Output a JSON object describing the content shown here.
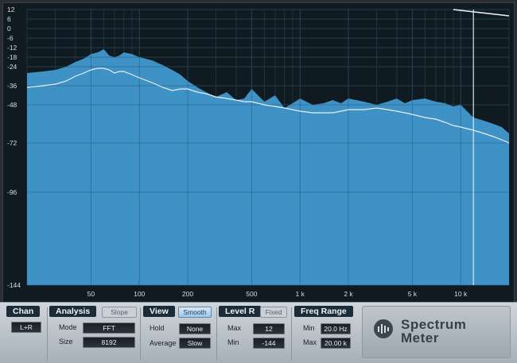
{
  "app": {
    "title": "Spectrum Meter"
  },
  "chart_data": {
    "type": "area",
    "x_scale": "log",
    "y_ticks": [
      12,
      6,
      0,
      -6,
      -12,
      -18,
      -24,
      -36,
      -48,
      -72,
      -96,
      -144
    ],
    "x_ticks": [
      {
        "value": 50,
        "label": "50"
      },
      {
        "value": 100,
        "label": "100"
      },
      {
        "value": 200,
        "label": "200"
      },
      {
        "value": 500,
        "label": "500"
      },
      {
        "value": 1000,
        "label": "1 k"
      },
      {
        "value": 2000,
        "label": "2 k"
      },
      {
        "value": 5000,
        "label": "5 k"
      },
      {
        "value": 10000,
        "label": "10 k"
      }
    ],
    "xlim": [
      20,
      20000
    ],
    "ylim": [
      -144,
      12
    ],
    "series": [
      {
        "color": "#3f92c6",
        "x": [
          20,
          25,
          30,
          35,
          40,
          45,
          50,
          55,
          60,
          65,
          70,
          75,
          80,
          90,
          100,
          120,
          140,
          160,
          180,
          200,
          230,
          260,
          300,
          350,
          400,
          450,
          500,
          600,
          700,
          800,
          900,
          1000,
          1200,
          1400,
          1600,
          1800,
          2000,
          2500,
          3000,
          3500,
          4000,
          4500,
          5000,
          6000,
          7000,
          8000,
          9000,
          10000,
          12000,
          14000,
          16000,
          18000,
          20000
        ],
        "y": [
          -28,
          -27,
          -26,
          -24,
          -21,
          -19,
          -16,
          -15,
          -13,
          -17,
          -18,
          -17,
          -15,
          -16,
          -18,
          -20,
          -23,
          -26,
          -29,
          -33,
          -37,
          -40,
          -43,
          -40,
          -45,
          -44,
          -38,
          -46,
          -42,
          -50,
          -47,
          -44,
          -48,
          -47,
          -45,
          -47,
          -44,
          -46,
          -48,
          -46,
          -44,
          -47,
          -45,
          -44,
          -46,
          -47,
          -49,
          -48,
          -56,
          -58,
          -60,
          -62,
          -66
        ]
      },
      {
        "color": "#e8eef2",
        "x": [
          20,
          25,
          30,
          35,
          40,
          45,
          50,
          55,
          60,
          65,
          70,
          75,
          80,
          90,
          100,
          120,
          140,
          160,
          180,
          200,
          230,
          260,
          300,
          350,
          400,
          450,
          500,
          600,
          700,
          800,
          900,
          1000,
          1200,
          1400,
          1600,
          1800,
          2000,
          2500,
          3000,
          3500,
          4000,
          4500,
          5000,
          6000,
          7000,
          8000,
          9000,
          10000,
          12000,
          14000,
          16000,
          18000,
          20000
        ],
        "y": [
          -37,
          -36,
          -35,
          -33,
          -30,
          -28,
          -26,
          -25,
          -25,
          -26,
          -28,
          -27,
          -27,
          -29,
          -31,
          -34,
          -37,
          -39,
          -38,
          -38,
          -40,
          -41,
          -43,
          -44,
          -45,
          -46,
          -46,
          -48,
          -49,
          -50,
          -51,
          -52,
          -53,
          -53,
          -53,
          -52,
          -51,
          -51,
          -50,
          -51,
          -52,
          -53,
          -54,
          -56,
          -57,
          -59,
          -61,
          -62,
          -64,
          -66,
          -68,
          -70,
          -72
        ]
      }
    ],
    "cursor_hz": 12000,
    "top_line": {
      "x": [
        9000,
        20000
      ],
      "y": [
        12,
        8
      ]
    }
  },
  "panel": {
    "chan": {
      "title": "Chan",
      "value": "L+R"
    },
    "analysis": {
      "title": "Analysis",
      "slope_label": "Slope",
      "mode_label": "Mode",
      "mode_value": "FFT",
      "size_label": "Size",
      "size_value": "8192"
    },
    "view": {
      "title": "View",
      "smooth_label": "Smooth",
      "hold_label": "Hold",
      "hold_value": "None",
      "average_label": "Average",
      "average_value": "Slow"
    },
    "level": {
      "title": "Level R",
      "fixed_label": "Fixed",
      "max_label": "Max",
      "max_value": "12",
      "min_label": "Min",
      "min_value": "-144"
    },
    "freq": {
      "title": "Freq Range",
      "min_label": "Min",
      "min_value": "20.0 Hz",
      "max_label": "Max",
      "max_value": "20.00 k"
    },
    "logo": {
      "line1": "Spectrum",
      "line2": "Meter"
    }
  }
}
